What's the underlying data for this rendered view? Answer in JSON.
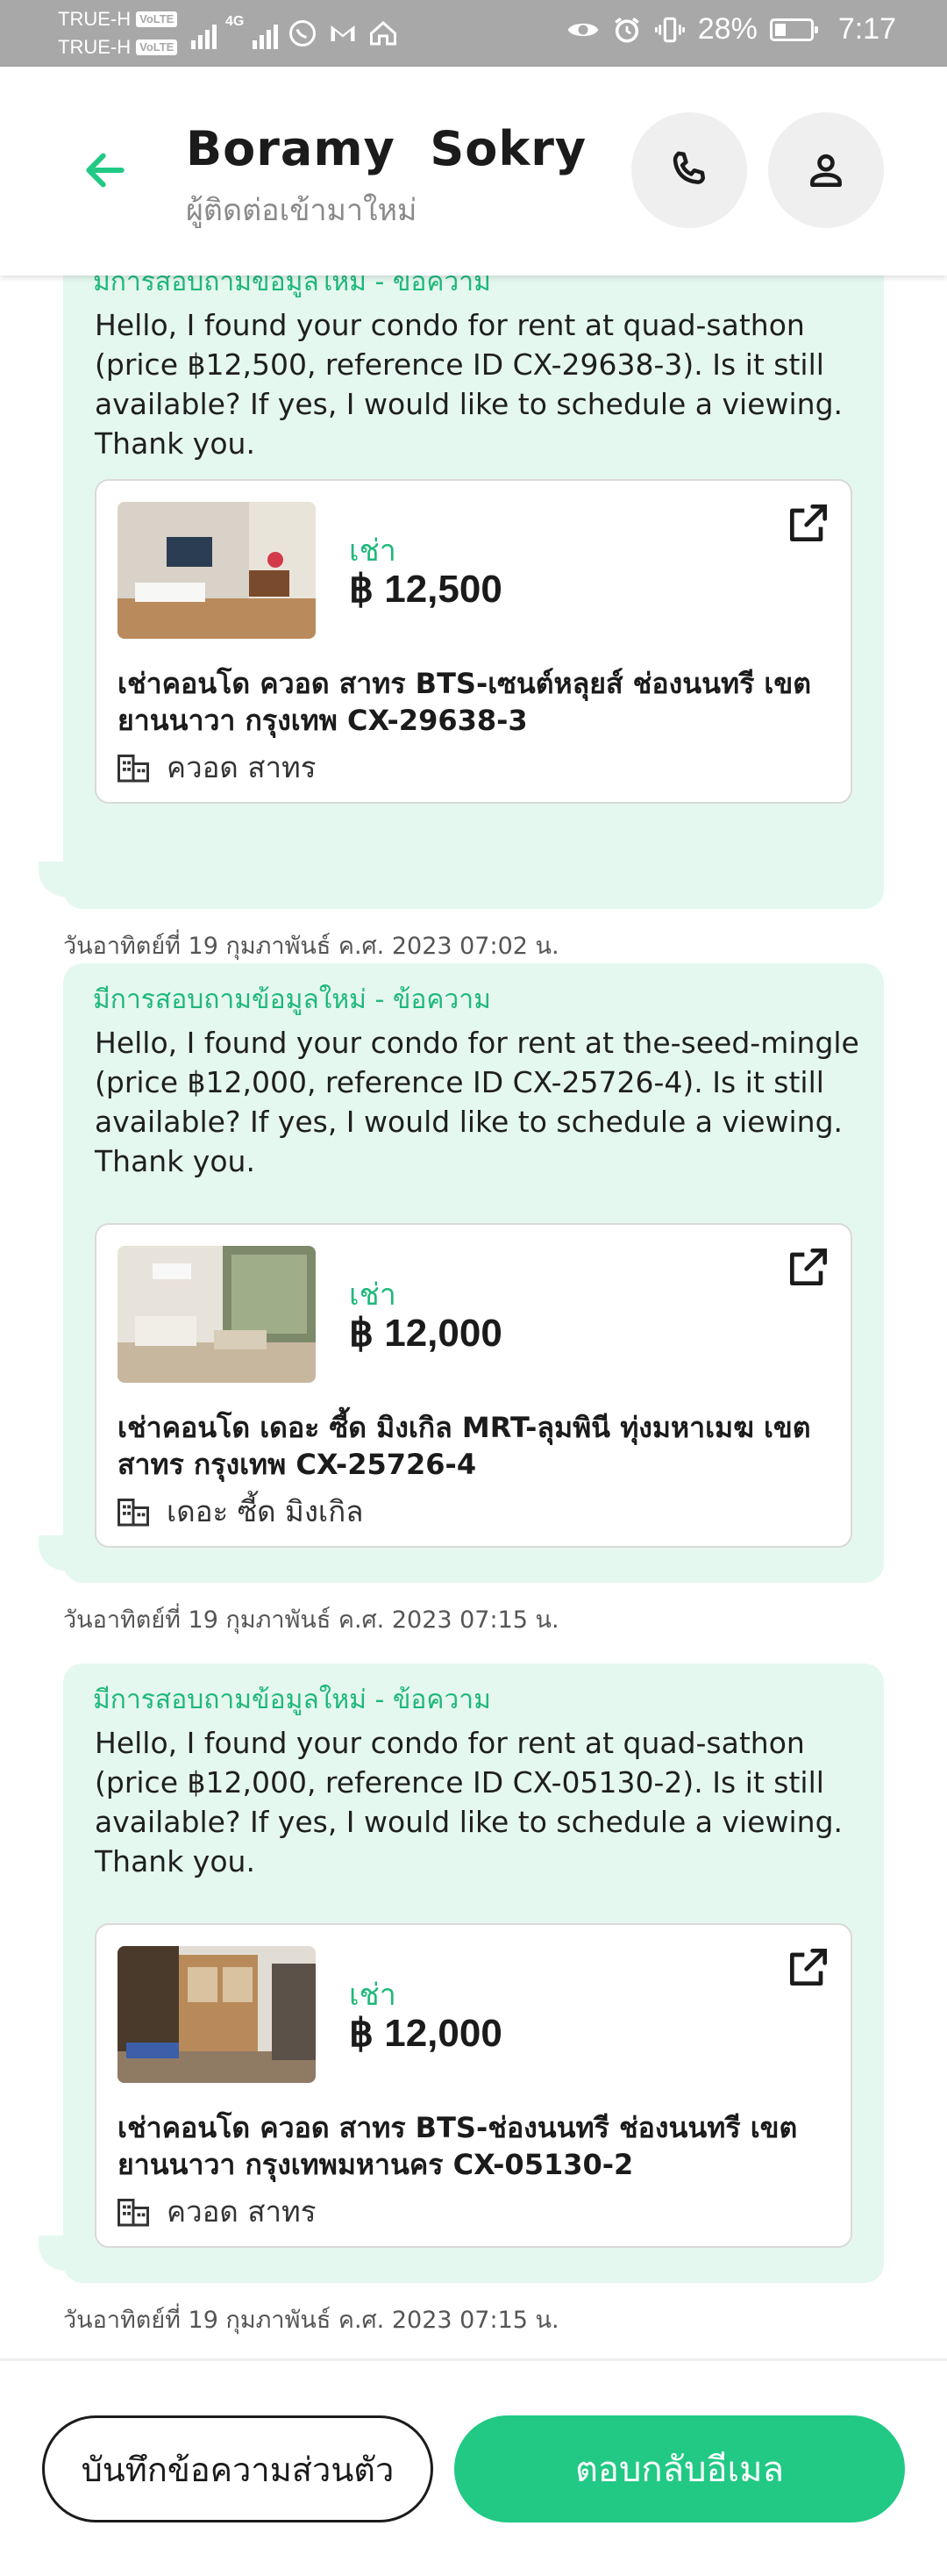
{
  "status_bar": {
    "carrier_1": "TRUE-H",
    "carrier_2": "TRUE-H",
    "volte": "VoLTE",
    "network": "4G",
    "battery": "28%",
    "time": "7:17"
  },
  "header": {
    "contact_name": "Boramy  Sokry",
    "contact_subtitle": "ผู้ติดต่อเข้ามาใหม่"
  },
  "messages": [
    {
      "label": "มีการสอบถามข้อมูลใหม่ - ข้อความ",
      "text": "Hello, I found your condo for rent at quad-sathon (price ฿12,500, reference ID CX-29638-3). Is it still available? If yes, I would like to schedule a viewing. Thank you.",
      "listing": {
        "type": "เช่า",
        "price": "฿ 12,500",
        "title": "เช่าคอนโด  ควอด สาทร BTS-เซนต์หลุยส์ ช่องนนทรี เขต ยานนาวา กรุงเทพ CX-29638-3",
        "building": "ควอด สาทร"
      },
      "timestamp": "วันอาทิตย์ที่ 19 กุมภาพันธ์ ค.ศ. 2023 07:02 น."
    },
    {
      "label": "มีการสอบถามข้อมูลใหม่ - ข้อความ",
      "text": "Hello, I found your condo for rent at the-seed-mingle (price ฿12,000, reference ID CX-25726-4). Is it still available? If yes, I would like to schedule a viewing. Thank you.",
      "listing": {
        "type": "เช่า",
        "price": "฿ 12,000",
        "title": "เช่าคอนโด  เดอะ ซี้ด มิงเกิล MRT-ลุมพินี ทุ่งมหาเมฆ เขต สาทร กรุงเทพ CX-25726-4",
        "building": "เดอะ ซี้ด มิงเกิล"
      },
      "timestamp": "วันอาทิตย์ที่ 19 กุมภาพันธ์ ค.ศ. 2023 07:15 น."
    },
    {
      "label": "มีการสอบถามข้อมูลใหม่ - ข้อความ",
      "text": "Hello, I found your condo for rent at quad-sathon (price ฿12,000, reference ID CX-05130-2). Is it still available? If yes, I would like to schedule a viewing. Thank you.",
      "listing": {
        "type": "เช่า",
        "price": "฿ 12,000",
        "title": "เช่าคอนโด ควอด สาทร BTS-ช่องนนทรี ช่องนนทรี เขต ยานนาวา กรุงเทพมหานคร CX-05130-2",
        "building": "ควอด สาทร"
      },
      "timestamp": "วันอาทิตย์ที่ 19 กุมภาพันธ์ ค.ศ. 2023 07:15 น."
    }
  ],
  "actions": {
    "note_label": "บันทึกข้อความส่วนตัว",
    "reply_label": "ตอบกลับอีเมล"
  },
  "colors": {
    "accent": "#21c985",
    "bubble": "#e5f8f0",
    "status_bar": "#a8a8a8"
  },
  "icons": {
    "back": "arrow-left-icon",
    "call": "phone-icon",
    "profile": "person-icon",
    "open": "open-external-icon",
    "building": "building-icon"
  }
}
